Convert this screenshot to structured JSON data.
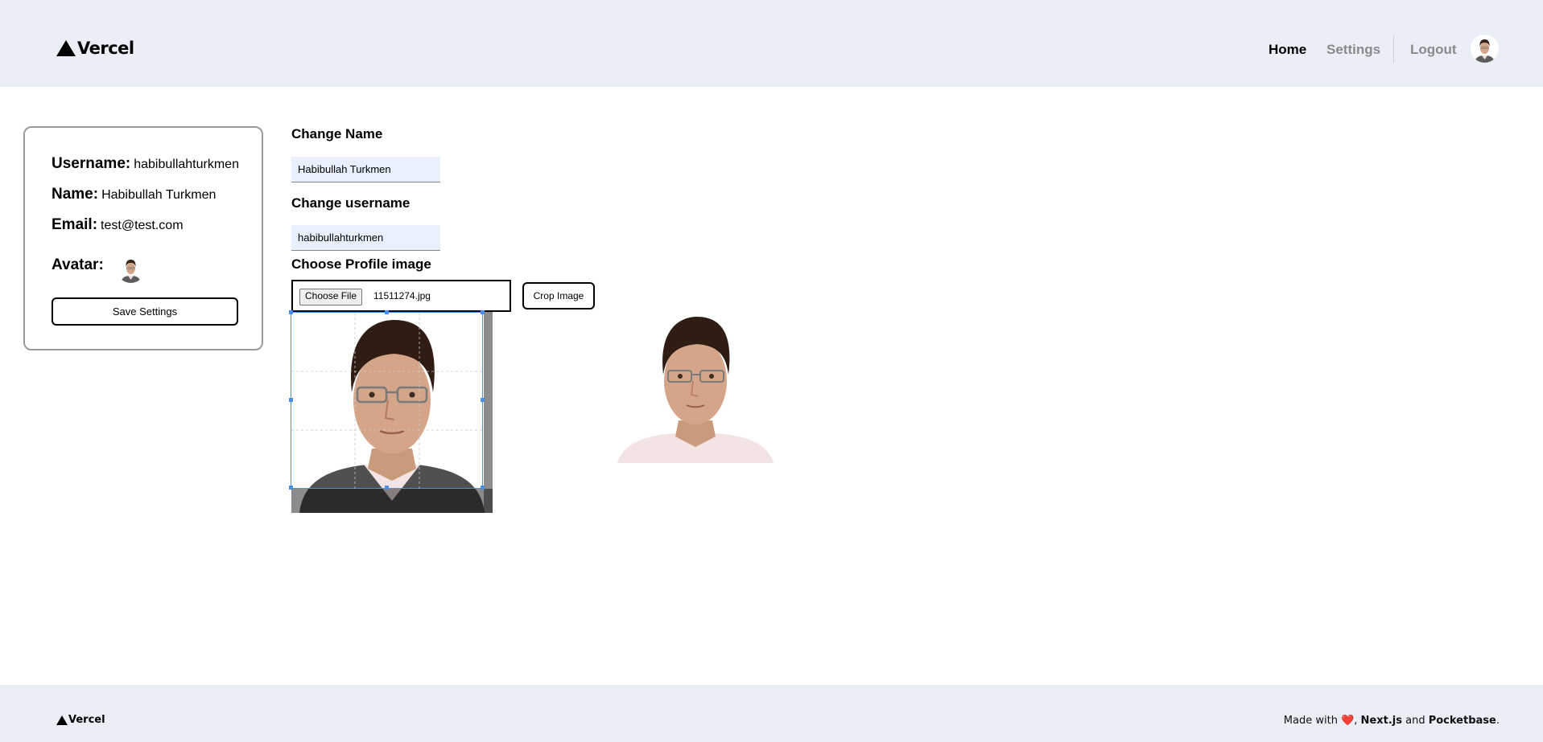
{
  "header": {
    "brand": "Vercel",
    "nav": {
      "home": "Home",
      "settings": "Settings",
      "logout": "Logout"
    }
  },
  "profile_card": {
    "username_label": "Username:",
    "username_value": "habibullahturkmen",
    "name_label": "Name:",
    "name_value": "Habibullah Turkmen",
    "email_label": "Email:",
    "email_value": "test@test.com",
    "avatar_label": "Avatar:",
    "save_button": "Save Settings"
  },
  "settings_form": {
    "change_name_title": "Change Name",
    "name_input_value": "Habibullah Turkmen",
    "change_username_title": "Change username",
    "username_input_value": "habibullahturkmen",
    "profile_image_title": "Choose Profile image",
    "choose_file_button": "Choose File",
    "chosen_file_name": "11511274.jpg",
    "crop_button": "Crop Image"
  },
  "footer": {
    "brand": "Vercel",
    "made_with": "Made with",
    "heart_icon": "❤️",
    "sep": ", ",
    "nextjs": "Next.js",
    "and": " and ",
    "pocketbase": "Pocketbase",
    "period": "."
  }
}
